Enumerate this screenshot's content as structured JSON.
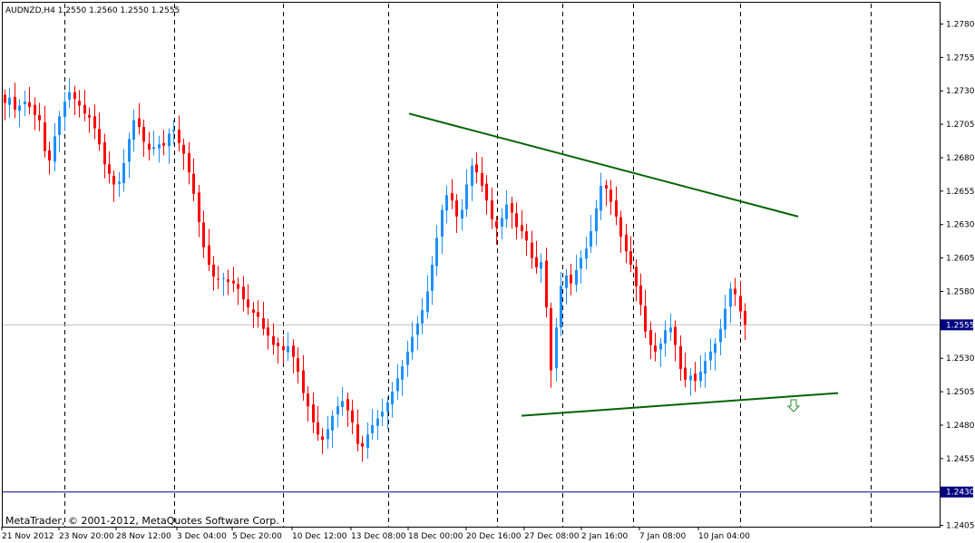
{
  "chart_data": {
    "type": "candlestick",
    "symbol_header": "AUDNZD,H4  1.2550  1.2560  1.2550  1.2555",
    "footer": "MetaTrader, © 2001-2012, MetaQuotes Software Corp.",
    "ylim": [
      1.2397,
      1.2793
    ],
    "y_ticks": [
      "1.2780",
      "1.2755",
      "1.2730",
      "1.2705",
      "1.2680",
      "1.2655",
      "1.2630",
      "1.2605",
      "1.2580",
      "1.2530",
      "1.2505",
      "1.2480",
      "1.2455",
      "1.2405"
    ],
    "current_price": "1.2555",
    "horizontal_level": "1.2430",
    "x_labels": [
      "21 Nov 2012",
      "23 Nov 20:00",
      "28 Nov 12:00",
      "3 Dec 04:00",
      "5 Dec 20:00",
      "10 Dec 12:00",
      "13 Dec 08:00",
      "18 Dec 00:00",
      "20 Dec 16:00",
      "27 Dec 08:00",
      "2 Jan 16:00",
      "7 Jan 08:00",
      "10 Jan 04:00"
    ],
    "grid": "vertical dashed separators",
    "colors": {
      "background": "#ffffff",
      "up_candle": "#1e90ff",
      "down_candle": "#ff0000",
      "trendline": "#006400",
      "level_line": "#000080",
      "bid_line": "#c0c0c0",
      "price_tag": "#000080",
      "arrow": "#2e8b2e"
    },
    "trendlines": [
      {
        "from": [
          "18 Dec",
          1.2713
        ],
        "to": [
          "9 Jan",
          1.2636
        ]
      },
      {
        "from": [
          "20 Dec",
          1.2487
        ],
        "to": [
          "11 Jan",
          1.2504
        ]
      }
    ],
    "arrow_icon": "down-arrow-icon",
    "close_path": [
      1.2721,
      1.2725,
      1.2716,
      1.2719,
      1.2722,
      1.2718,
      1.2712,
      1.2708,
      1.2685,
      1.2678,
      1.2696,
      1.2711,
      1.2722,
      1.2729,
      1.2724,
      1.2719,
      1.2713,
      1.271,
      1.2702,
      1.269,
      1.2675,
      1.2668,
      1.266,
      1.2662,
      1.2676,
      1.2694,
      1.2708,
      1.2703,
      1.2692,
      1.2686,
      1.2688,
      1.269,
      1.2689,
      1.2698,
      1.2701,
      1.2691,
      1.2683,
      1.2669,
      1.2653,
      1.2632,
      1.2613,
      1.26,
      1.2591,
      1.2589,
      1.259,
      1.2587,
      1.2586,
      1.2582,
      1.2574,
      1.2568,
      1.2564,
      1.2561,
      1.2552,
      1.2547,
      1.254,
      1.2539,
      1.2536,
      1.2539,
      1.2531,
      1.252,
      1.2504,
      1.2494,
      1.2482,
      1.2473,
      1.2469,
      1.2477,
      1.2487,
      1.2494,
      1.2498,
      1.2491,
      1.2482,
      1.2466,
      1.2464,
      1.2473,
      1.248,
      1.2485,
      1.249,
      1.2497,
      1.2505,
      1.2515,
      1.2524,
      1.2535,
      1.2546,
      1.2556,
      1.2566,
      1.258,
      1.26,
      1.262,
      1.2641,
      1.2652,
      1.2648,
      1.2636,
      1.2641,
      1.266,
      1.2674,
      1.2669,
      1.2659,
      1.2648,
      1.2634,
      1.2628,
      1.2635,
      1.2645,
      1.2639,
      1.2628,
      1.2625,
      1.2618,
      1.2605,
      1.2598,
      1.2602,
      1.2568,
      1.2521,
      1.2553,
      1.2584,
      1.2592,
      1.2586,
      1.2596,
      1.2605,
      1.2612,
      1.2625,
      1.2642,
      1.2659,
      1.2657,
      1.2647,
      1.2636,
      1.2621,
      1.261,
      1.26,
      1.2584,
      1.257,
      1.255,
      1.254,
      1.2535,
      1.2541,
      1.2551,
      1.2553,
      1.254,
      1.2522,
      1.2514,
      1.2517,
      1.2513,
      1.252,
      1.2528,
      1.2535,
      1.2541,
      1.2552,
      1.2567,
      1.2582,
      1.2578,
      1.2565,
      1.2555
    ]
  }
}
